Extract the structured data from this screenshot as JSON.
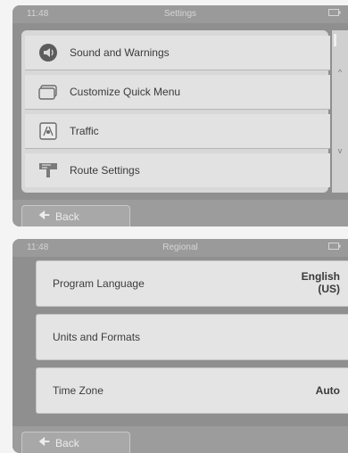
{
  "screen1": {
    "status": {
      "time": "11:48",
      "title": "Settings",
      "battery": ""
    },
    "menu_items": [
      {
        "label": "Sound and Warnings",
        "icon": "sound-icon"
      },
      {
        "label": "Customize Quick Menu",
        "icon": "quick-menu-icon"
      },
      {
        "label": "Traffic",
        "icon": "traffic-icon"
      },
      {
        "label": "Route Settings",
        "icon": "route-settings-icon"
      }
    ],
    "scroll": {
      "up": "^",
      "down": "v"
    },
    "back_label": "Back"
  },
  "screen2": {
    "status": {
      "time": "11:48",
      "title": "Regional",
      "battery": ""
    },
    "rows": [
      {
        "label": "Program Language",
        "value_line1": "English",
        "value_line2": "(US)"
      },
      {
        "label": "Units and Formats",
        "value_line1": "",
        "value_line2": ""
      },
      {
        "label": "Time Zone",
        "value_line1": "Auto",
        "value_line2": ""
      }
    ],
    "back_label": "Back"
  },
  "colors": {
    "frame": "#8f8f8f",
    "item_bg": "#e2e2e2",
    "text": "#3a3a3a",
    "back_text": "#ededed"
  }
}
